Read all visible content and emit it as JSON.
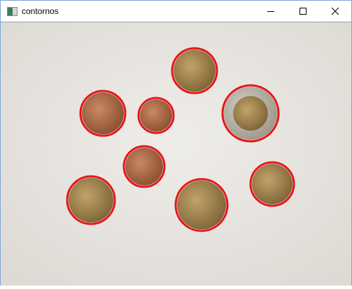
{
  "window": {
    "title": "contornos"
  },
  "controls": {
    "minimize": "minimize-icon",
    "maximize": "maximize-icon",
    "close": "close-icon"
  },
  "colors": {
    "contour": "#e8141c",
    "background": "#e9e7e2"
  }
}
